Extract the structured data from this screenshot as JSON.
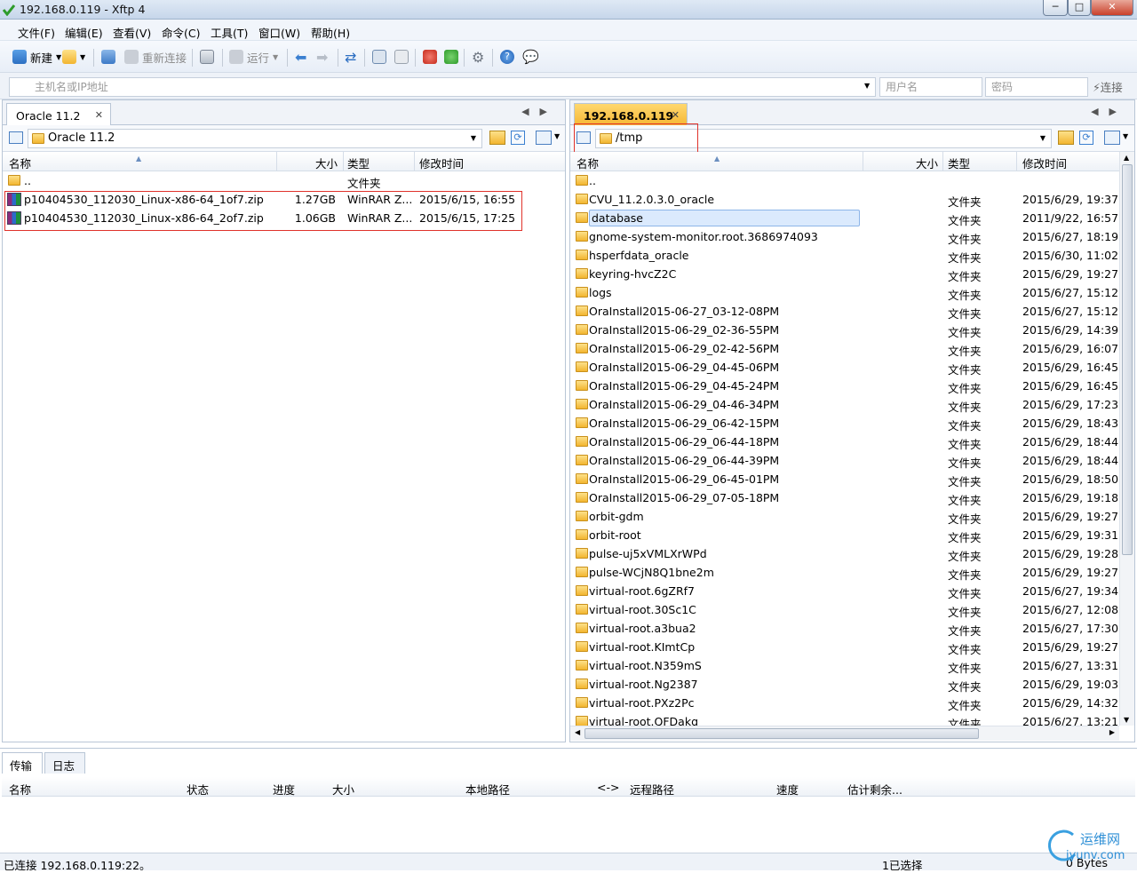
{
  "window": {
    "title": "192.168.0.119 - Xftp 4",
    "minimize": "─",
    "maximize": "□",
    "close": "✕"
  },
  "menu": [
    "文件(F)",
    "编辑(E)",
    "查看(V)",
    "命令(C)",
    "工具(T)",
    "窗口(W)",
    "帮助(H)"
  ],
  "toolbar": {
    "new_label": "新建",
    "reconnect_label": "重新连接",
    "run_label": "运行"
  },
  "address": {
    "host_placeholder": "主机名或IP地址",
    "user_placeholder": "用户名",
    "password_placeholder": "密码",
    "connect_label": "连接"
  },
  "left": {
    "tab": "Oracle 11.2",
    "path": "Oracle 11.2",
    "columns": {
      "name": "名称",
      "size": "大小",
      "type": "类型",
      "modified": "修改时间"
    },
    "rows": [
      {
        "name": "..",
        "size": "",
        "type": "文件夹",
        "modified": "",
        "kind": "folder"
      },
      {
        "name": "p10404530_112030_Linux-x86-64_1of7.zip",
        "size": "1.27GB",
        "type": "WinRAR Z...",
        "modified": "2015/6/15, 16:55",
        "kind": "zip"
      },
      {
        "name": "p10404530_112030_Linux-x86-64_2of7.zip",
        "size": "1.06GB",
        "type": "WinRAR Z...",
        "modified": "2015/6/15, 17:25",
        "kind": "zip"
      }
    ]
  },
  "right": {
    "tab": "192.168.0.119",
    "path": "/tmp",
    "columns": {
      "name": "名称",
      "size": "大小",
      "type": "类型",
      "modified": "修改时间"
    },
    "rows": [
      {
        "name": "..",
        "type": "",
        "modified": ""
      },
      {
        "name": "CVU_11.2.0.3.0_oracle",
        "type": "文件夹",
        "modified": "2015/6/29, 19:37"
      },
      {
        "name": "database",
        "type": "文件夹",
        "modified": "2011/9/22, 16:57",
        "selected": true
      },
      {
        "name": "gnome-system-monitor.root.3686974093",
        "type": "文件夹",
        "modified": "2015/6/27, 18:19"
      },
      {
        "name": "hsperfdata_oracle",
        "type": "文件夹",
        "modified": "2015/6/30, 11:02"
      },
      {
        "name": "keyring-hvcZ2C",
        "type": "文件夹",
        "modified": "2015/6/29, 19:27"
      },
      {
        "name": "logs",
        "type": "文件夹",
        "modified": "2015/6/27, 15:12"
      },
      {
        "name": "OraInstall2015-06-27_03-12-08PM",
        "type": "文件夹",
        "modified": "2015/6/27, 15:12"
      },
      {
        "name": "OraInstall2015-06-29_02-36-55PM",
        "type": "文件夹",
        "modified": "2015/6/29, 14:39"
      },
      {
        "name": "OraInstall2015-06-29_02-42-56PM",
        "type": "文件夹",
        "modified": "2015/6/29, 16:07"
      },
      {
        "name": "OraInstall2015-06-29_04-45-06PM",
        "type": "文件夹",
        "modified": "2015/6/29, 16:45"
      },
      {
        "name": "OraInstall2015-06-29_04-45-24PM",
        "type": "文件夹",
        "modified": "2015/6/29, 16:45"
      },
      {
        "name": "OraInstall2015-06-29_04-46-34PM",
        "type": "文件夹",
        "modified": "2015/6/29, 17:23"
      },
      {
        "name": "OraInstall2015-06-29_06-42-15PM",
        "type": "文件夹",
        "modified": "2015/6/29, 18:43"
      },
      {
        "name": "OraInstall2015-06-29_06-44-18PM",
        "type": "文件夹",
        "modified": "2015/6/29, 18:44"
      },
      {
        "name": "OraInstall2015-06-29_06-44-39PM",
        "type": "文件夹",
        "modified": "2015/6/29, 18:44"
      },
      {
        "name": "OraInstall2015-06-29_06-45-01PM",
        "type": "文件夹",
        "modified": "2015/6/29, 18:50"
      },
      {
        "name": "OraInstall2015-06-29_07-05-18PM",
        "type": "文件夹",
        "modified": "2015/6/29, 19:18"
      },
      {
        "name": "orbit-gdm",
        "type": "文件夹",
        "modified": "2015/6/29, 19:27"
      },
      {
        "name": "orbit-root",
        "type": "文件夹",
        "modified": "2015/6/29, 19:31"
      },
      {
        "name": "pulse-uj5xVMLXrWPd",
        "type": "文件夹",
        "modified": "2015/6/29, 19:28"
      },
      {
        "name": "pulse-WCjN8Q1bne2m",
        "type": "文件夹",
        "modified": "2015/6/29, 19:27"
      },
      {
        "name": "virtual-root.6gZRf7",
        "type": "文件夹",
        "modified": "2015/6/27, 19:34"
      },
      {
        "name": "virtual-root.30Sc1C",
        "type": "文件夹",
        "modified": "2015/6/27, 12:08"
      },
      {
        "name": "virtual-root.a3bua2",
        "type": "文件夹",
        "modified": "2015/6/27, 17:30"
      },
      {
        "name": "virtual-root.KImtCp",
        "type": "文件夹",
        "modified": "2015/6/29, 19:27"
      },
      {
        "name": "virtual-root.N359mS",
        "type": "文件夹",
        "modified": "2015/6/27, 13:31"
      },
      {
        "name": "virtual-root.Ng2387",
        "type": "文件夹",
        "modified": "2015/6/29, 19:03"
      },
      {
        "name": "virtual-root.PXz2Pc",
        "type": "文件夹",
        "modified": "2015/6/29, 14:32"
      },
      {
        "name": "virtual-root.QFDakq",
        "type": "文件夹",
        "modified": "2015/6/27, 13:21"
      }
    ]
  },
  "transfer": {
    "tabs": [
      "传输",
      "日志"
    ],
    "columns": [
      "名称",
      "状态",
      "进度",
      "大小",
      "本地路径",
      "<->",
      "远程路径",
      "速度",
      "估计剩余..."
    ]
  },
  "status": {
    "left": "已连接 192.168.0.119:22。",
    "selected": "1已选择",
    "bytes": "0 Bytes"
  },
  "watermark": {
    "line1": "运维网",
    "line2": "iyunv.com"
  },
  "colors": {
    "accent": "#f5b632",
    "selection": "#dbeafd",
    "highlight_box": "#e0322b"
  }
}
